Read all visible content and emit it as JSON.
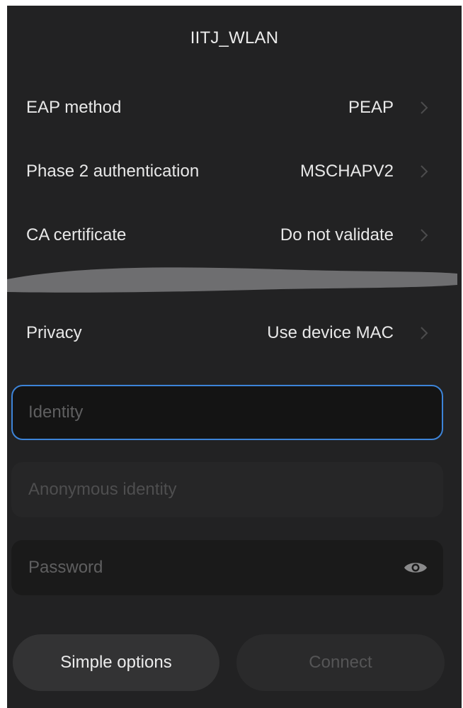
{
  "dialog": {
    "title": "IITJ_WLAN"
  },
  "settings": [
    {
      "label": "EAP method",
      "value": "PEAP"
    },
    {
      "label": "Phase 2 authentication",
      "value": "MSCHAPV2"
    },
    {
      "label": "CA certificate",
      "value": "Do not validate"
    },
    {
      "label": "Privacy",
      "value": "Use device MAC"
    }
  ],
  "fields": {
    "identity_placeholder": "Identity",
    "identity_value": "",
    "anonymous_identity_placeholder": "Anonymous identity",
    "anonymous_identity_value": "",
    "password_placeholder": "Password",
    "password_value": ""
  },
  "buttons": {
    "simple_options": "Simple options",
    "connect": "Connect"
  },
  "icons": {
    "chevron": "chevron-right-icon",
    "password_toggle": "eye-icon"
  },
  "colors": {
    "background": "#222223",
    "focus_border": "#3d84d8",
    "redaction": "#6e6e70"
  }
}
